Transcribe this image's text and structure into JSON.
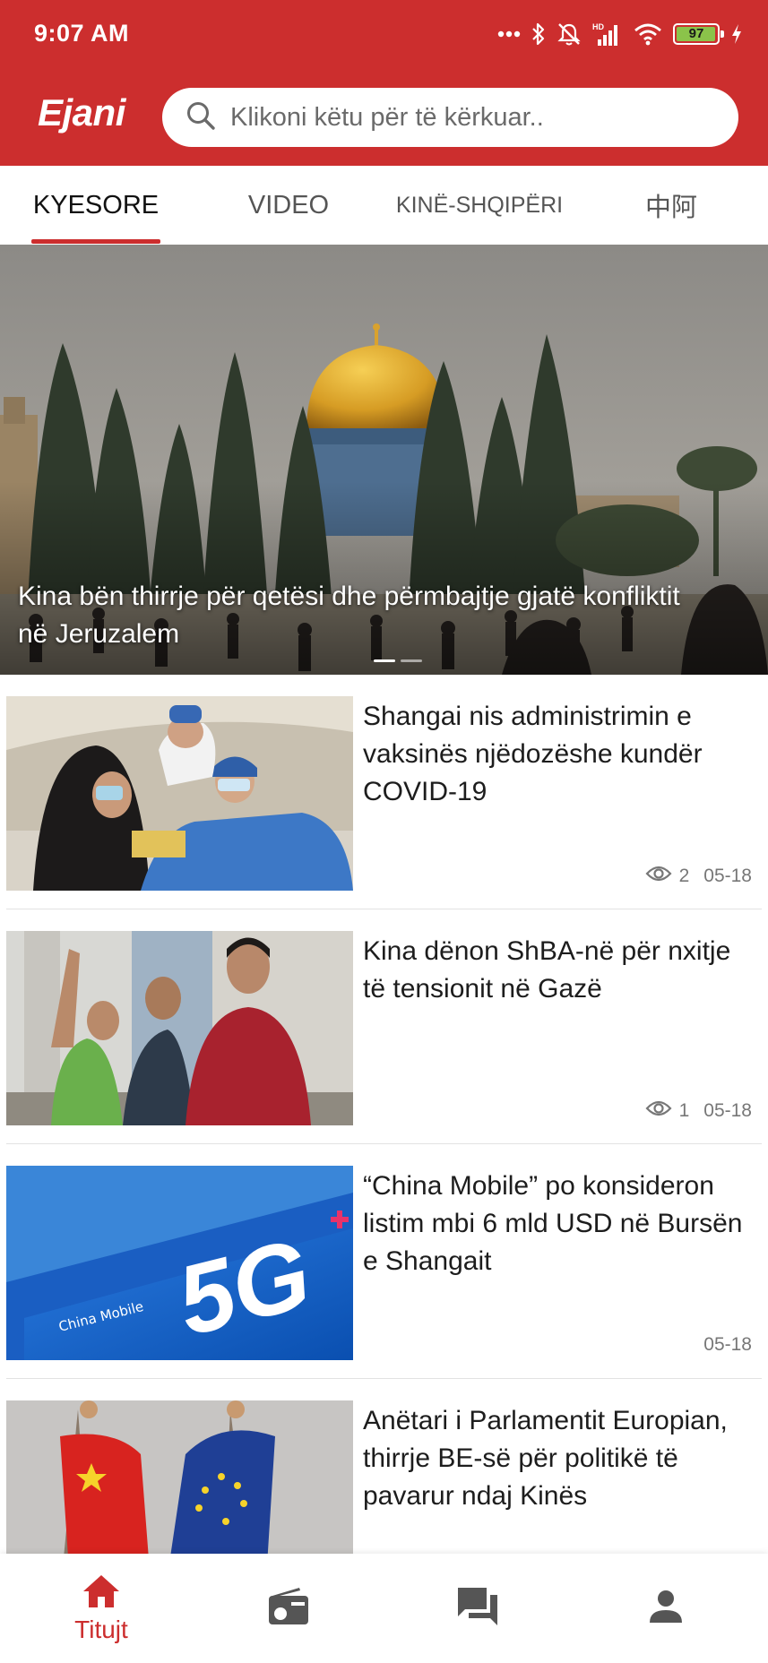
{
  "status_bar": {
    "time": "9:07 AM",
    "battery": "97",
    "battery_level": 0.97,
    "icons": [
      "more-dots-icon",
      "bluetooth-icon",
      "mute-icon",
      "hd-signal-icon",
      "wifi-icon",
      "battery-icon",
      "charging-icon"
    ]
  },
  "header": {
    "logo": "Ejani",
    "search_placeholder": "Klikoni këtu për të kërkuar..",
    "brand_color": "#cc2e2e"
  },
  "tabs": [
    {
      "label": "KYESORE",
      "active": true
    },
    {
      "label": "VIDEO",
      "active": false
    },
    {
      "label": "KINË-SHQIPËRI",
      "active": false
    },
    {
      "label": "中阿",
      "active": false
    }
  ],
  "hero": {
    "title": "Kina bën thirrje për qetësi dhe përmbajtje gjatë konfliktit në Jeruzalem",
    "slide_count": 2,
    "active_slide": 1
  },
  "articles": [
    {
      "title": "Shangai nis administrimin e vaksinës njëdozëshe kundër COVID-19",
      "views": "2",
      "date": "05-18"
    },
    {
      "title": "Kina dënon ShBA-në për nxitje të tensionit në Gazë",
      "views": "1",
      "date": "05-18"
    },
    {
      "title": "“China Mobile” po konsideron listim mbi 6 mld USD në Bursën e Shangait",
      "views": "",
      "date": "05-18"
    },
    {
      "title": "Anëtari i Parlamentit Europian, thirrje BE-së për politikë të pavarur ndaj Kinës",
      "views": "",
      "date": ""
    }
  ],
  "bottom_nav": [
    {
      "label": "Titujt",
      "icon": "home-icon",
      "active": true
    },
    {
      "label": "",
      "icon": "radio-icon",
      "active": false
    },
    {
      "label": "",
      "icon": "chat-icon",
      "active": false
    },
    {
      "label": "",
      "icon": "person-icon",
      "active": false
    }
  ]
}
